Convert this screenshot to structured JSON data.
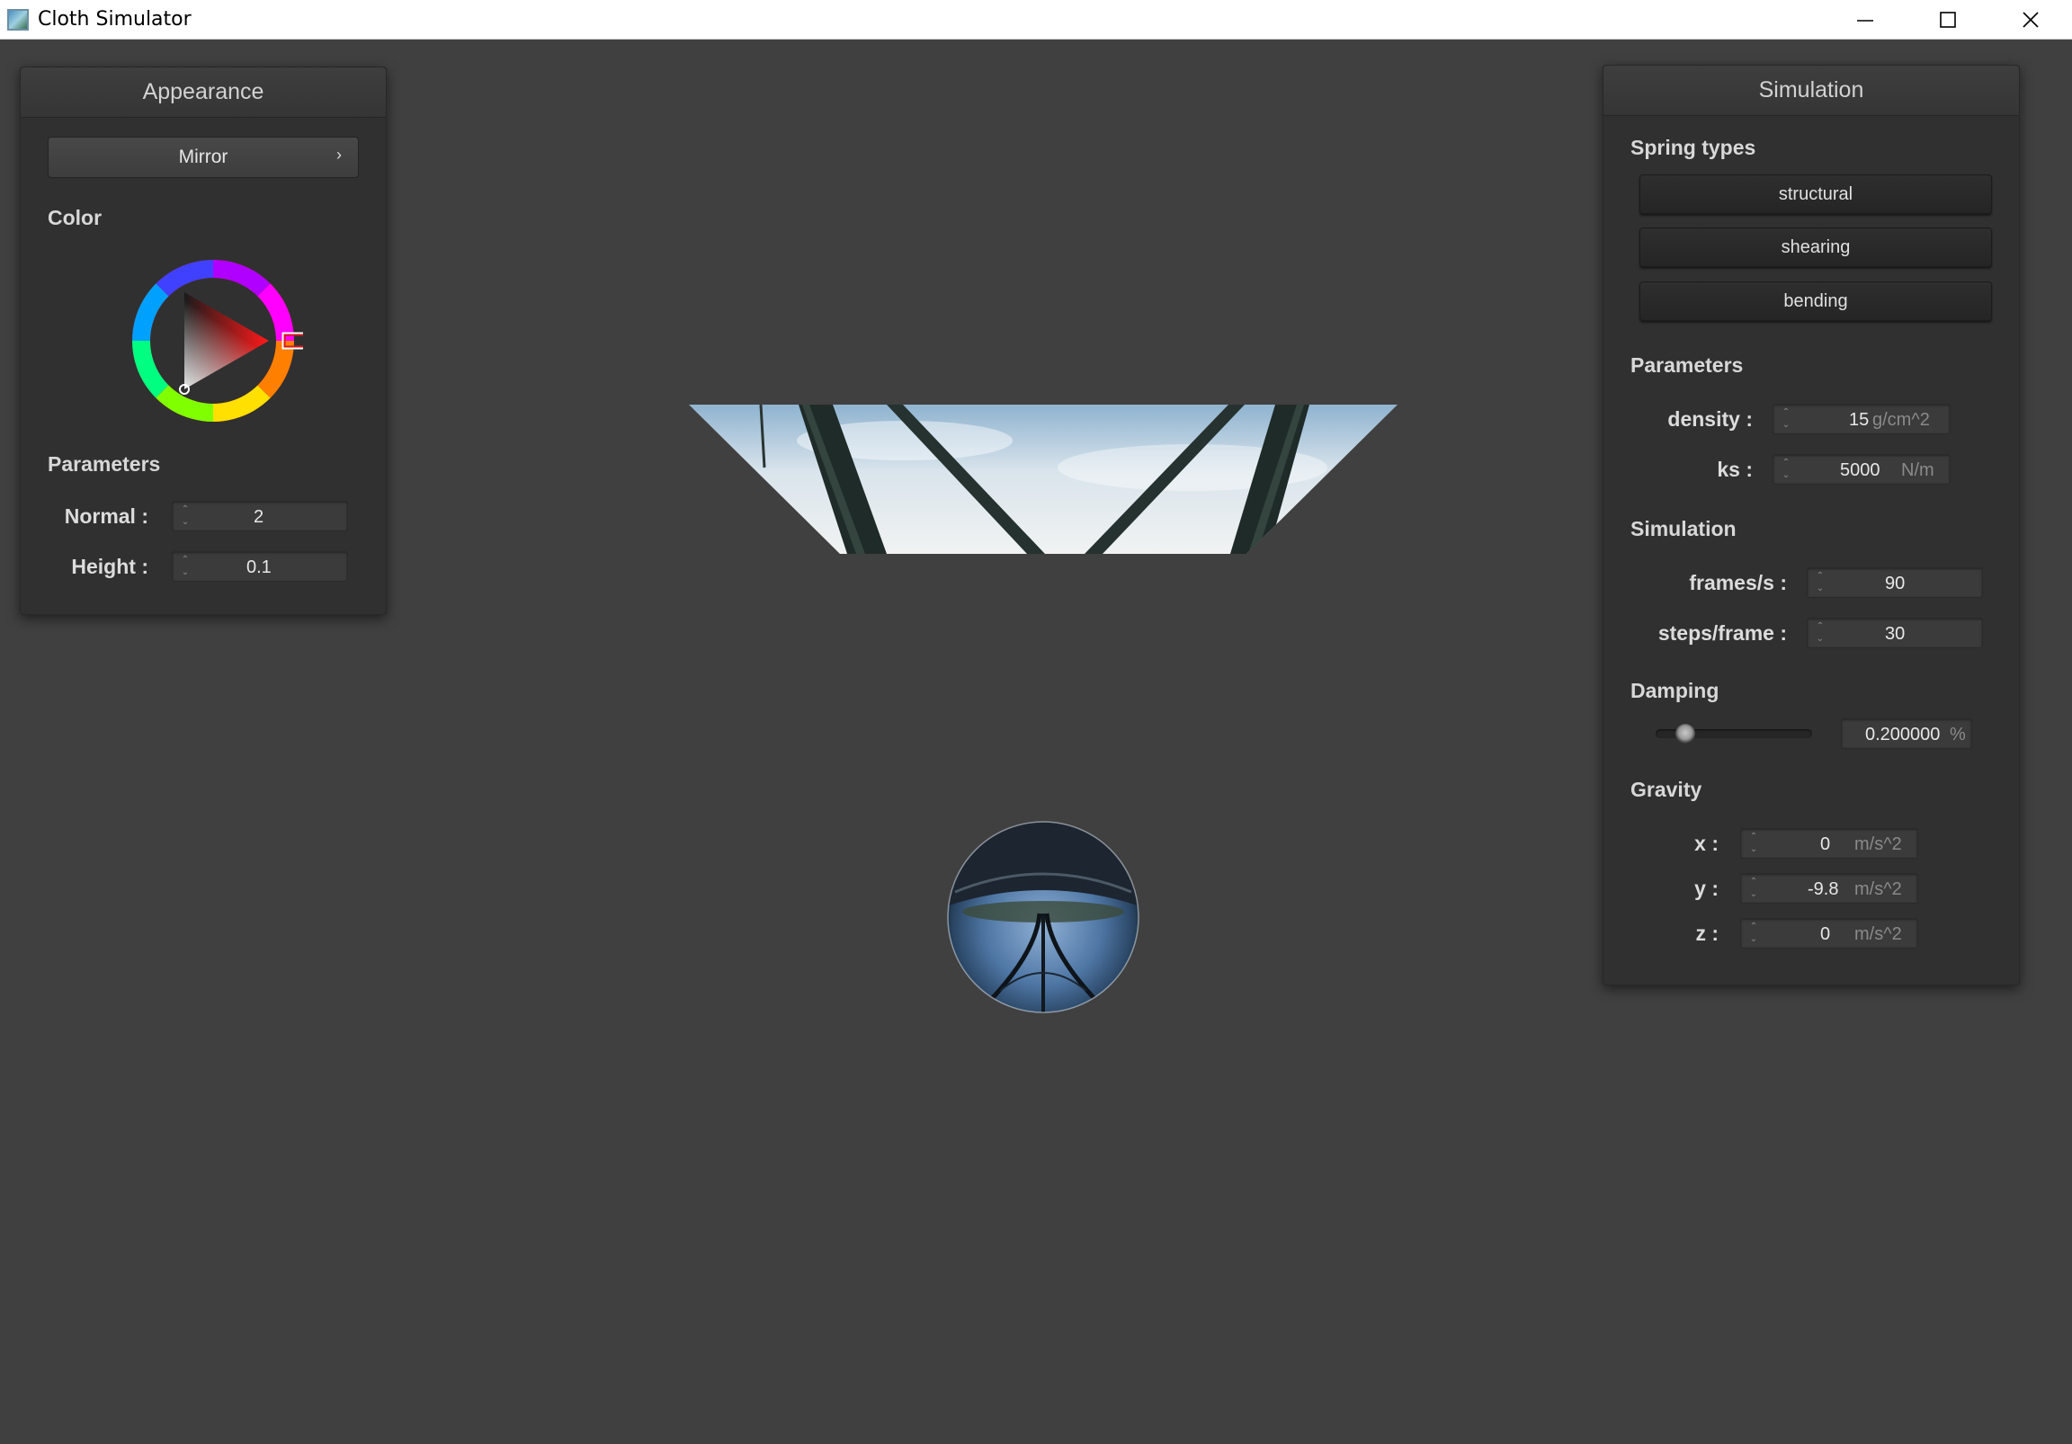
{
  "window": {
    "title": "Cloth Simulator"
  },
  "appearance_panel": {
    "title": "Appearance",
    "shader_combo": "Mirror",
    "shader_chevron": "›",
    "color_label": "Color",
    "color_wheel_selected": "#ff2020",
    "parameters_label": "Parameters",
    "fields": [
      {
        "label": "Normal :",
        "value": "2"
      },
      {
        "label": "Height :",
        "value": "0.1"
      }
    ]
  },
  "simulation_panel": {
    "title": "Simulation",
    "spring_types_label": "Spring types",
    "spring_buttons": [
      "structural",
      "shearing",
      "bending"
    ],
    "parameters_label": "Parameters",
    "parameters": [
      {
        "label": "density :",
        "value": "15",
        "unit": "g/cm^2"
      },
      {
        "label": "ks :",
        "value": "5000",
        "unit": "N/m"
      }
    ],
    "simulation_label": "Simulation",
    "simulation": [
      {
        "label": "frames/s :",
        "value": "90"
      },
      {
        "label": "steps/frame :",
        "value": "30"
      }
    ],
    "damping_label": "Damping",
    "damping_value": "0.200000",
    "damping_unit": "%",
    "damping_slider_fraction": 0.2,
    "gravity_label": "Gravity",
    "gravity": [
      {
        "label": "x :",
        "value": "0",
        "unit": "m/s^2"
      },
      {
        "label": "y :",
        "value": "-9.8",
        "unit": "m/s^2"
      },
      {
        "label": "z :",
        "value": "0",
        "unit": "m/s^2"
      }
    ]
  },
  "scene": {
    "cloth": "mirror-cloth",
    "sphere": "mirror-sphere",
    "background_color": "#404040"
  }
}
